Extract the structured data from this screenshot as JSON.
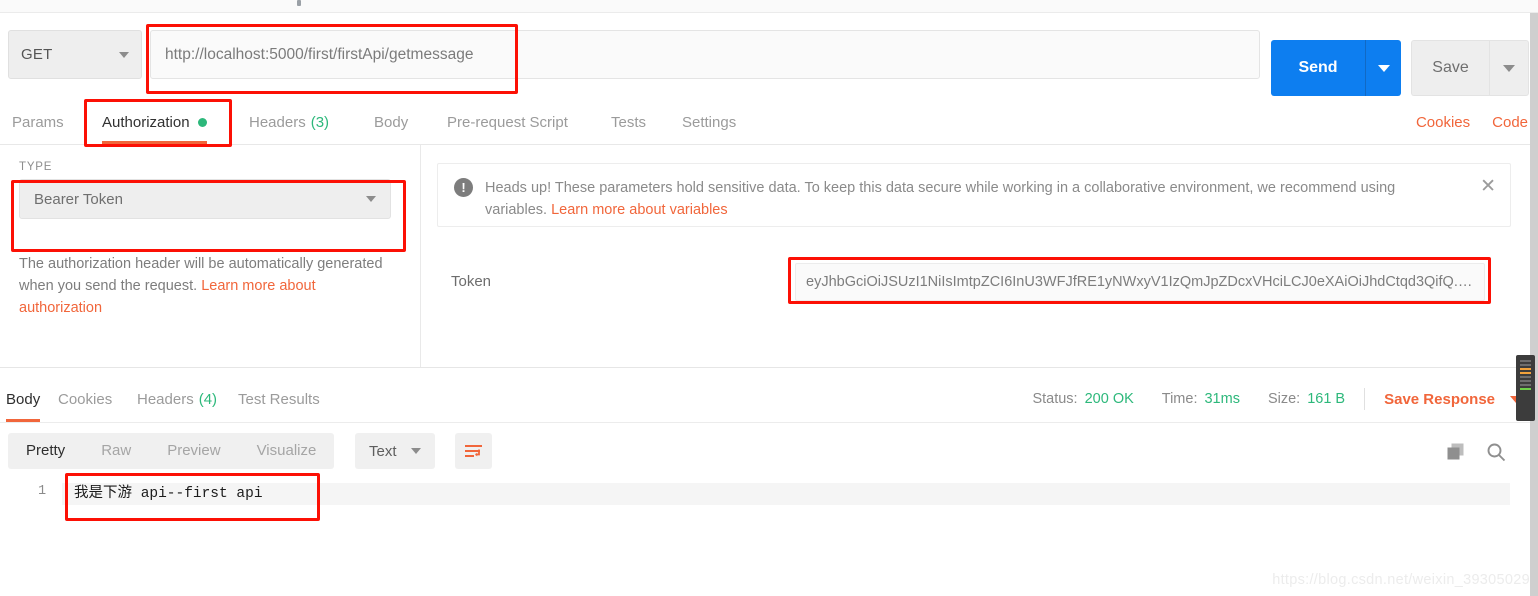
{
  "request": {
    "method": "GET",
    "url": "http://localhost:5000/first/firstApi/getmessage",
    "send_label": "Send",
    "save_label": "Save",
    "tabs": [
      {
        "label": "Params",
        "count": "",
        "active": false,
        "dot": false
      },
      {
        "label": "Authorization",
        "count": "",
        "active": true,
        "dot": true
      },
      {
        "label": "Headers",
        "count": "(3)",
        "active": false,
        "dot": false
      },
      {
        "label": "Body",
        "count": "",
        "active": false,
        "dot": false
      },
      {
        "label": "Pre-request Script",
        "count": "",
        "active": false,
        "dot": false
      },
      {
        "label": "Tests",
        "count": "",
        "active": false,
        "dot": false
      },
      {
        "label": "Settings",
        "count": "",
        "active": false,
        "dot": false
      }
    ],
    "cookies_link": "Cookies",
    "code_link": "Code"
  },
  "auth": {
    "type_label": "TYPE",
    "type_value": "Bearer Token",
    "note_text": "The authorization header will be automatically generated when you send the request. ",
    "note_link": "Learn more about authorization",
    "warning": {
      "icon": "alert-icon",
      "text": "Heads up! These parameters hold sensitive data. To keep this data secure while working in a collaborative environment, we recommend using variables. ",
      "link": "Learn more about variables",
      "close": "✕"
    },
    "token_label": "Token",
    "token_value": "eyJhbGciOiJSUzI1NiIsImtpZCI6InU3WFJfRE1yNWxyV1IzQmJpZDcxVHciLCJ0eXAiOiJhdCtqd3QifQ.e..."
  },
  "response": {
    "tabs": [
      {
        "label": "Body",
        "count": "",
        "active": true
      },
      {
        "label": "Cookies",
        "count": "",
        "active": false
      },
      {
        "label": "Headers",
        "count": "(4)",
        "active": false
      },
      {
        "label": "Test Results",
        "count": "",
        "active": false
      }
    ],
    "status_key": "Status:",
    "status_value": "200 OK",
    "time_key": "Time:",
    "time_value": "31ms",
    "size_key": "Size:",
    "size_value": "161 B",
    "save_response": "Save Response",
    "format_tabs": [
      {
        "label": "Pretty",
        "active": true
      },
      {
        "label": "Raw",
        "active": false
      },
      {
        "label": "Preview",
        "active": false
      },
      {
        "label": "Visualize",
        "active": false
      }
    ],
    "content_type": "Text",
    "line_number": "1",
    "body_text": "我是下游 api--first api"
  },
  "watermark": "https://blog.csdn.net/weixin_39305029",
  "colors": {
    "accent_orange": "#f1663b",
    "send_blue": "#0d7ef0",
    "status_green": "#2db87b",
    "annotation_red": "#fc1005"
  }
}
